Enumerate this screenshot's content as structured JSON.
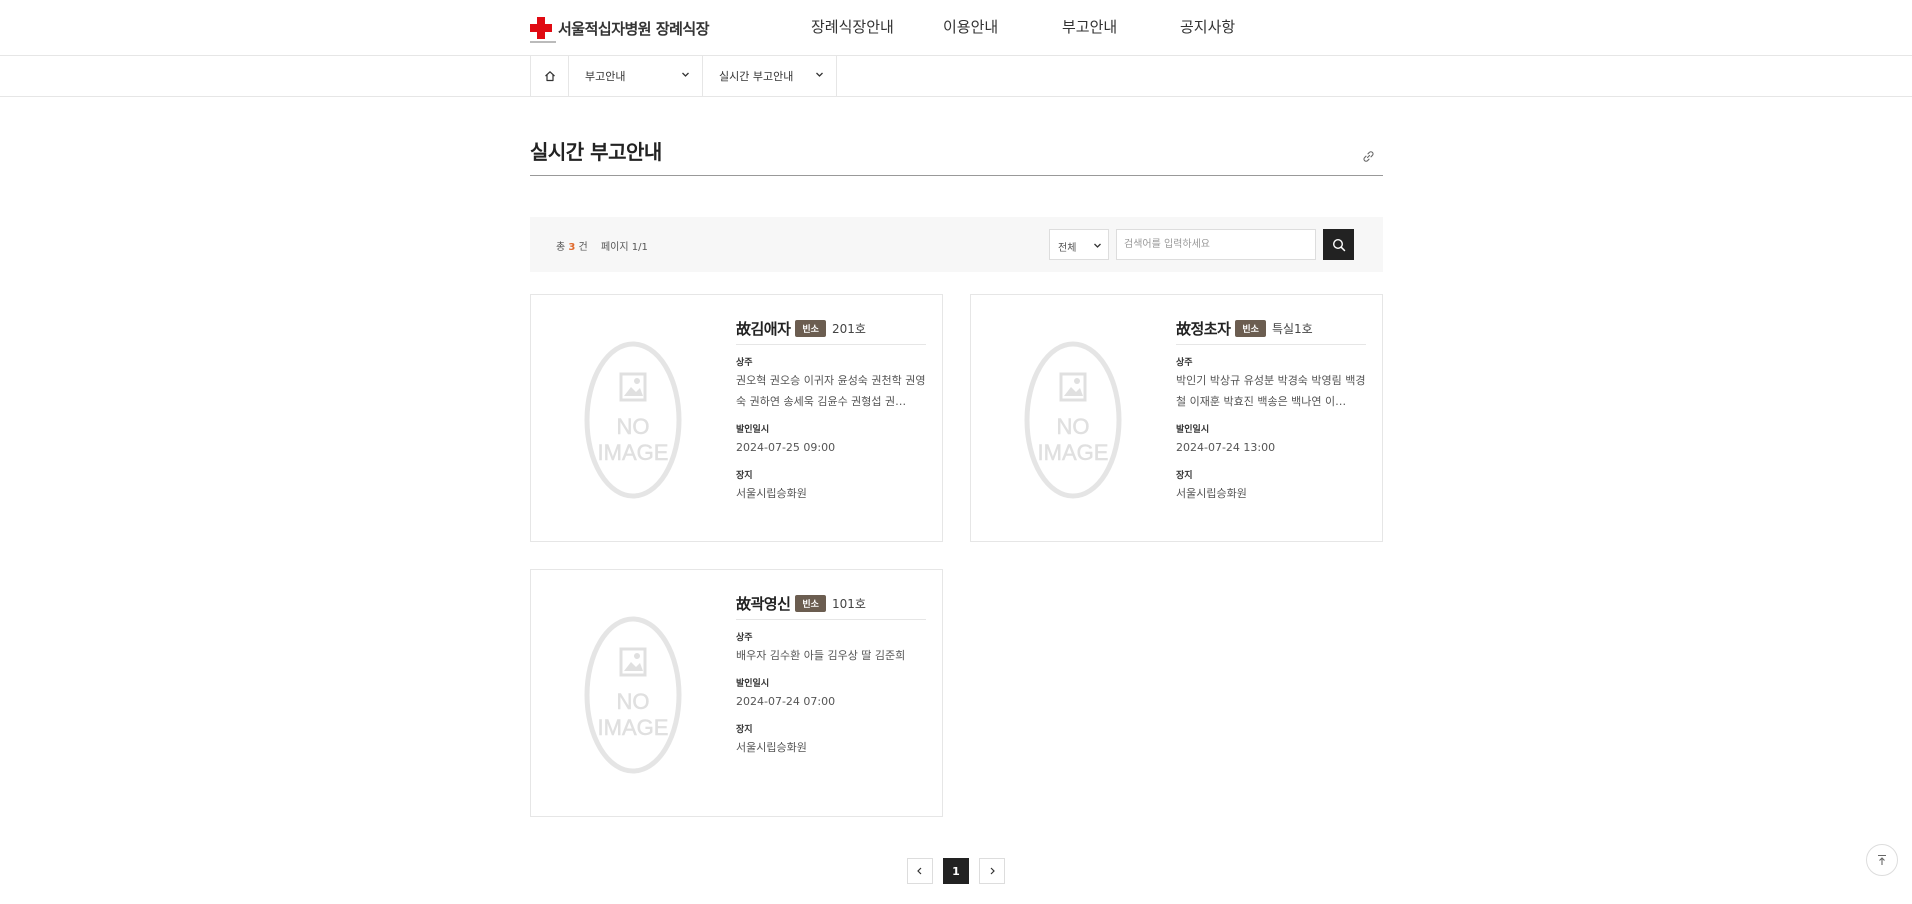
{
  "header": {
    "logo_text": "서울적십자병원 장례식장",
    "nav": [
      "장례식장안내",
      "이용안내",
      "부고안내",
      "공지사항"
    ]
  },
  "subnav": {
    "dropdown1": "부고안내",
    "dropdown2": "실시간 부고안내"
  },
  "page_title": "실시간 부고안내",
  "search": {
    "count_prefix": "총",
    "count_value": "3",
    "count_suffix": "건",
    "page_info": "페이지 1/1",
    "select_value": "전체",
    "placeholder": "검색어를 입력하세요"
  },
  "cards": [
    {
      "name": "故김애자",
      "badge": "빈소",
      "room": "201호",
      "mourners_label": "상주",
      "mourners": "권오혁 권오승 이귀자 윤성숙 권천학 권영숙 권하연 송세욱 김윤수 권형섭 권…",
      "departure_label": "발인일시",
      "departure": "2024-07-25 09:00",
      "place_label": "장지",
      "place": "서울시립승화원"
    },
    {
      "name": "故정초자",
      "badge": "빈소",
      "room": "특실1호",
      "mourners_label": "상주",
      "mourners": "박인기 박상규 유성분 박경숙 박영림 백경철 이재훈 박효진 백송은 백나연 이…",
      "departure_label": "발인일시",
      "departure": "2024-07-24 13:00",
      "place_label": "장지",
      "place": "서울시립승화원"
    },
    {
      "name": "故곽영신",
      "badge": "빈소",
      "room": "101호",
      "mourners_label": "상주",
      "mourners": "배우자 김수환 아들 김우상 딸 김준희",
      "departure_label": "발인일시",
      "departure": "2024-07-24 07:00",
      "place_label": "장지",
      "place": "서울시립승화원"
    }
  ],
  "pagination": {
    "current": "1"
  },
  "colors": {
    "brand_red": "#e00a12",
    "badge_brown": "#6b5d50",
    "count_orange": "#e06a2c"
  }
}
